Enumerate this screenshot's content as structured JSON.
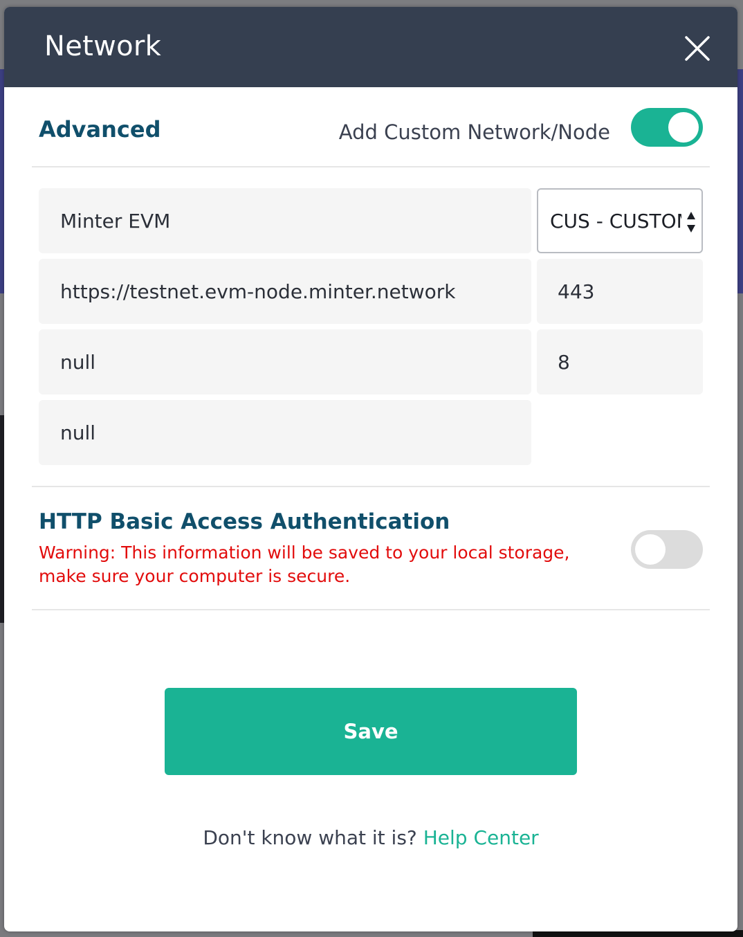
{
  "modal": {
    "title": "Network",
    "close_icon": "close-icon"
  },
  "advanced": {
    "title": "Advanced",
    "custom_node_label": "Add Custom Network/Node",
    "custom_node_enabled": true
  },
  "fields": {
    "name": {
      "value": "Minter EVM"
    },
    "currency": {
      "selected": "CUS - CUSTOM"
    },
    "url": {
      "value": "https://testnet.evm-node.minter.network"
    },
    "port": {
      "value": "443"
    },
    "field_a": {
      "value": "null"
    },
    "decimals": {
      "value": "8"
    },
    "field_b": {
      "value": "null"
    }
  },
  "auth": {
    "title": "HTTP Basic Access Authentication",
    "warning": "Warning: This information will be saved to your local storage, make sure your computer is secure.",
    "enabled": false
  },
  "actions": {
    "save_label": "Save"
  },
  "help": {
    "prompt": "Don't know what it is?",
    "link_text": "Help Center"
  },
  "colors": {
    "header_bg": "#353f50",
    "accent": "#1ab394",
    "heading": "#104f6b",
    "warning": "#e20c0c"
  }
}
